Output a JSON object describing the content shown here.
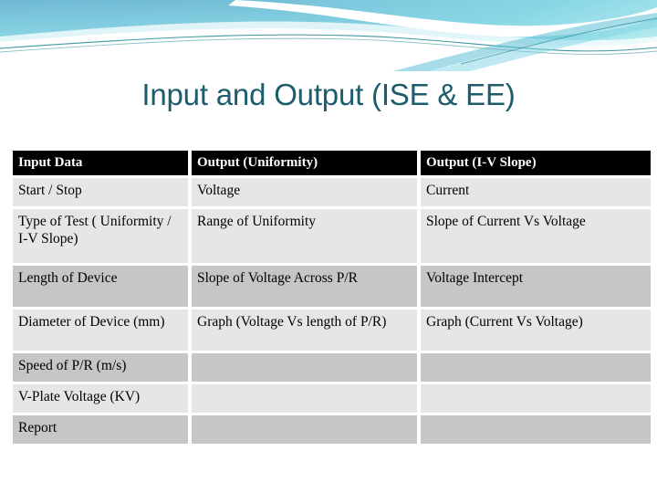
{
  "slide": {
    "title": "Input and Output (ISE & EE)"
  },
  "banner": {
    "name": "decorative-wave-banner",
    "gradient_top": "#7ec3da",
    "gradient_bottom": "#8fe0ea",
    "accent_line": "#1d8a93",
    "swoosh": "#ffffff"
  },
  "table": {
    "name": "input-output-table",
    "header_background": "#000000",
    "header_text_color": "#ffffff",
    "row_shade_light": "#e6e6e6",
    "row_shade_dark": "#c6c6c6",
    "columns": [
      "Input Data",
      "Output (Uniformity)",
      "Output (I-V Slope)"
    ],
    "rows": [
      {
        "shade": "light",
        "height": "short",
        "cells": [
          "Start / Stop",
          "Voltage",
          "Current"
        ]
      },
      {
        "shade": "light",
        "height": "tall",
        "cells": [
          "Type of Test ( Uniformity / I-V Slope)",
          "Range of Uniformity",
          "Slope of Current Vs Voltage"
        ]
      },
      {
        "shade": "dark",
        "height": "mid",
        "cells": [
          "Length of Device",
          "Slope of Voltage Across P/R",
          "Voltage Intercept"
        ]
      },
      {
        "shade": "light",
        "height": "mid",
        "cells": [
          "Diameter of Device (mm)",
          "Graph (Voltage Vs length of P/R)",
          "Graph (Current Vs Voltage)"
        ]
      },
      {
        "shade": "dark",
        "height": "short",
        "cells": [
          "Speed of  P/R (m/s)",
          "",
          ""
        ]
      },
      {
        "shade": "light",
        "height": "short",
        "cells": [
          "V-Plate Voltage (KV)",
          "",
          ""
        ]
      },
      {
        "shade": "dark",
        "height": "short",
        "cells": [
          "Report",
          "",
          ""
        ]
      }
    ]
  }
}
